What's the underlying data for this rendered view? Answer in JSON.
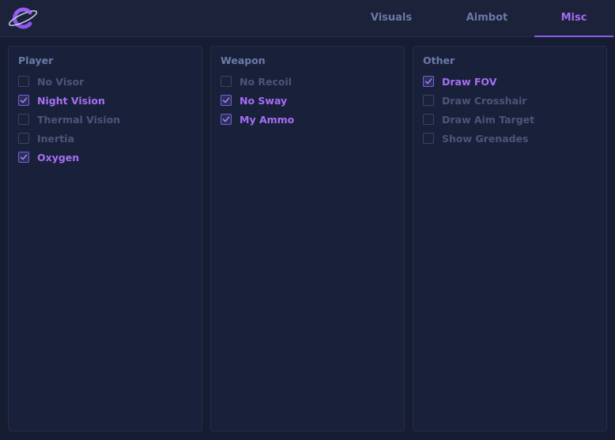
{
  "header": {
    "logo_icon": "planet-c-logo-icon",
    "tabs": [
      {
        "label": "Visuals",
        "active": false
      },
      {
        "label": "Aimbot",
        "active": false
      },
      {
        "label": "Misc",
        "active": true
      }
    ]
  },
  "panels": {
    "player": {
      "title": "Player",
      "options": [
        {
          "label": "No Visor",
          "checked": false
        },
        {
          "label": "Night Vision",
          "checked": true
        },
        {
          "label": "Thermal Vision",
          "checked": false
        },
        {
          "label": "Inertia",
          "checked": false
        },
        {
          "label": "Oxygen",
          "checked": true
        }
      ]
    },
    "weapon": {
      "title": "Weapon",
      "options": [
        {
          "label": "No Recoil",
          "checked": false
        },
        {
          "label": "No Sway",
          "checked": true
        },
        {
          "label": "My Ammo",
          "checked": true
        }
      ]
    },
    "other": {
      "title": "Other",
      "options": [
        {
          "label": "Draw FOV",
          "checked": true
        },
        {
          "label": "Draw Crosshair",
          "checked": false
        },
        {
          "label": "Draw Aim Target",
          "checked": false
        },
        {
          "label": "Show Grenades",
          "checked": false
        }
      ]
    }
  },
  "colors": {
    "accent": "#a46cf2",
    "inactive_text": "#4a5679",
    "title_text": "#6c7ba8",
    "background": "#161d33"
  }
}
